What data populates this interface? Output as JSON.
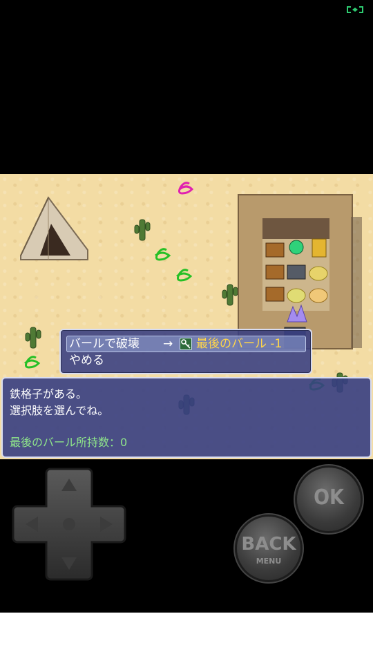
{
  "choices": {
    "option1": {
      "label": "バールで破壊",
      "arrow": "→",
      "item": "最後のバール -1"
    },
    "option2": {
      "label": "やめる"
    }
  },
  "message": {
    "line1": "鉄格子がある。",
    "line2": "選択肢を選んでね。",
    "line3": "最後のバール所持数：0"
  },
  "controls": {
    "ok_label": "OK",
    "back_label": "BACK",
    "menu_label": "MENU"
  },
  "icons": {
    "fullscreen": "fullscreen-icon",
    "key": "key-icon"
  },
  "colors": {
    "window_bg": "#373e82",
    "highlight_text": "#ffd64a",
    "info_text": "#8fe68a",
    "sand": "#f3dca4"
  }
}
